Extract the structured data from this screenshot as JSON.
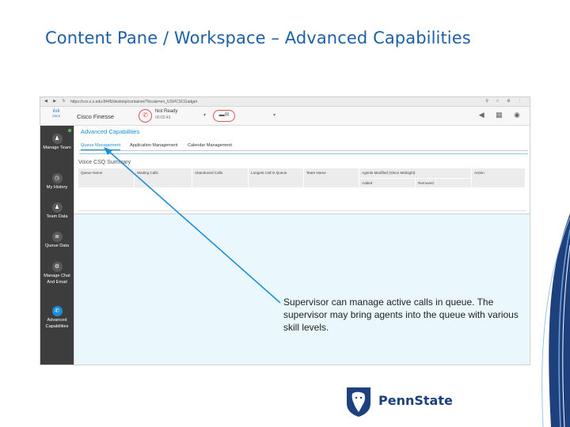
{
  "slide": {
    "title": "Content Pane / Workspace – Advanced Capabilities",
    "callout": "Supervisor can manage active calls in queue. The supervisor may bring agents into the queue with various skill levels.",
    "logo_text": "PennState"
  },
  "browser": {
    "url": "https://ccx.x.x.edu:8445/desktop/container/?locale=en_US#/CSCGadget",
    "nav_icons": [
      "back-icon",
      "forward-icon",
      "reload-icon"
    ]
  },
  "finesse": {
    "brand": "cisco",
    "app_name": "Cisco Finesse",
    "agent_state": "Not Ready",
    "state_timer": "00:02:43"
  },
  "sidebar": {
    "items": [
      {
        "label": "Manage Team",
        "icon": "manage-team-icon"
      },
      {
        "label": "My History",
        "icon": "history-icon"
      },
      {
        "label": "Team Data",
        "icon": "team-data-icon"
      },
      {
        "label": "Queue Data",
        "icon": "queue-data-icon"
      },
      {
        "label": "Manage Chat And Email",
        "icon": "gear-icon"
      },
      {
        "label": "Advanced Capabilities",
        "icon": "advanced-icon"
      }
    ]
  },
  "gadget": {
    "title": "Advanced Capabilities",
    "tabs": [
      {
        "label": "Queue Management",
        "active": true
      },
      {
        "label": "Application Management",
        "active": false
      },
      {
        "label": "Calendar Management",
        "active": false
      }
    ],
    "section_title": "Voice CSQ Summary",
    "columns": [
      "Queue Name",
      "Waiting Calls",
      "Abandoned Calls",
      "Longest Call in Queue",
      "Team Name",
      "Agents Modified (Since Midnight)",
      "Action"
    ],
    "subcolumns": [
      "Added",
      "Removed"
    ]
  },
  "colors": {
    "title_blue": "#1f5fa5",
    "finesse_blue": "#1a8ed6",
    "alert_red": "#d9534f",
    "sidebar_dark": "#3d3d3d",
    "psu_navy": "#1e407c"
  }
}
